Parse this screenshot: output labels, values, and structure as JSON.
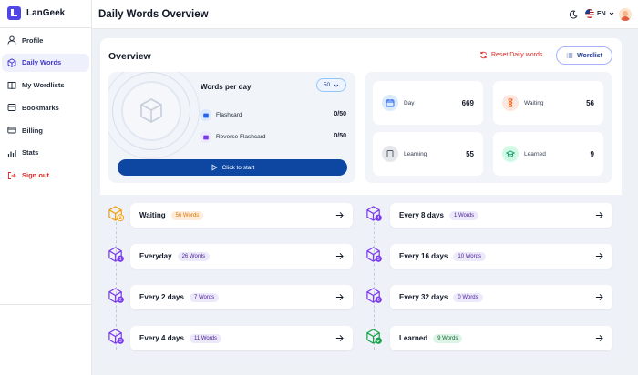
{
  "app": {
    "name": "LanGeek"
  },
  "sidebar": {
    "items": [
      {
        "label": "Profile",
        "icon": "user-icon"
      },
      {
        "label": "Daily Words",
        "icon": "cube-icon"
      },
      {
        "label": "My Wordlists",
        "icon": "book-icon"
      },
      {
        "label": "Bookmarks",
        "icon": "bookmark-icon"
      },
      {
        "label": "Billing",
        "icon": "card-icon"
      },
      {
        "label": "Stats",
        "icon": "chart-icon"
      },
      {
        "label": "Sign out",
        "icon": "logout-icon"
      }
    ]
  },
  "header": {
    "title": "Daily Words Overview",
    "language": "EN"
  },
  "overview": {
    "title": "Overview",
    "reset_label": "Reset Daily words",
    "wordlist_label": "Wordlist",
    "words_per_day_label": "Words per day",
    "words_per_day_value": "50",
    "flashcard_label": "Flashcard",
    "flashcard_count": "0/50",
    "reverse_label": "Reverse Flashcard",
    "reverse_count": "0/50",
    "start_label": "Click to start"
  },
  "stats": [
    {
      "label": "Day",
      "value": "669"
    },
    {
      "label": "Waiting",
      "value": "56"
    },
    {
      "label": "Learning",
      "value": "55"
    },
    {
      "label": "Learned",
      "value": "9"
    }
  ],
  "timeline": {
    "left": [
      {
        "title": "Waiting",
        "badge": "56 Words",
        "step": ""
      },
      {
        "title": "Everyday",
        "badge": "26 Words",
        "step": "1"
      },
      {
        "title": "Every 2 days",
        "badge": "7 Words",
        "step": "2"
      },
      {
        "title": "Every 4 days",
        "badge": "11 Words",
        "step": "3"
      }
    ],
    "right": [
      {
        "title": "Every 8 days",
        "badge": "1 Words",
        "step": "4"
      },
      {
        "title": "Every 16 days",
        "badge": "10 Words",
        "step": "5"
      },
      {
        "title": "Every 32 days",
        "badge": "0 Words",
        "step": "6"
      },
      {
        "title": "Learned",
        "badge": "9 Words",
        "step": ""
      }
    ]
  },
  "colors": {
    "accent": "#4338ca",
    "primary_button": "#0d47a1",
    "danger": "#dc2626",
    "waiting": "#f59e0b",
    "learned": "#16a34a"
  }
}
